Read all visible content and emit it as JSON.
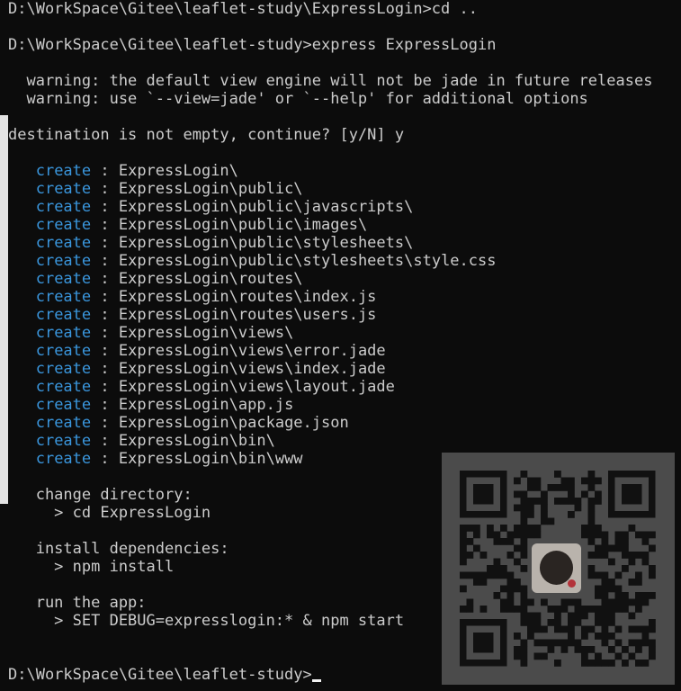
{
  "terminal": {
    "lines": [
      {
        "text": "D:\\WorkSpace\\Gitee\\leaflet-study\\ExpressLogin>cd .."
      },
      {
        "text": ""
      },
      {
        "text": "D:\\WorkSpace\\Gitee\\leaflet-study>express ExpressLogin"
      },
      {
        "text": ""
      },
      {
        "text": "  warning: the default view engine will not be jade in future releases"
      },
      {
        "text": "  warning: use `--view=jade' or `--help' for additional options"
      },
      {
        "text": ""
      },
      {
        "text": "destination is not empty, continue? [y/N] y"
      },
      {
        "text": ""
      },
      {
        "indent": "   ",
        "keyword": "create",
        "text": " : ExpressLogin\\"
      },
      {
        "indent": "   ",
        "keyword": "create",
        "text": " : ExpressLogin\\public\\"
      },
      {
        "indent": "   ",
        "keyword": "create",
        "text": " : ExpressLogin\\public\\javascripts\\"
      },
      {
        "indent": "   ",
        "keyword": "create",
        "text": " : ExpressLogin\\public\\images\\"
      },
      {
        "indent": "   ",
        "keyword": "create",
        "text": " : ExpressLogin\\public\\stylesheets\\"
      },
      {
        "indent": "   ",
        "keyword": "create",
        "text": " : ExpressLogin\\public\\stylesheets\\style.css"
      },
      {
        "indent": "   ",
        "keyword": "create",
        "text": " : ExpressLogin\\routes\\"
      },
      {
        "indent": "   ",
        "keyword": "create",
        "text": " : ExpressLogin\\routes\\index.js"
      },
      {
        "indent": "   ",
        "keyword": "create",
        "text": " : ExpressLogin\\routes\\users.js"
      },
      {
        "indent": "   ",
        "keyword": "create",
        "text": " : ExpressLogin\\views\\"
      },
      {
        "indent": "   ",
        "keyword": "create",
        "text": " : ExpressLogin\\views\\error.jade"
      },
      {
        "indent": "   ",
        "keyword": "create",
        "text": " : ExpressLogin\\views\\index.jade"
      },
      {
        "indent": "   ",
        "keyword": "create",
        "text": " : ExpressLogin\\views\\layout.jade"
      },
      {
        "indent": "   ",
        "keyword": "create",
        "text": " : ExpressLogin\\app.js"
      },
      {
        "indent": "   ",
        "keyword": "create",
        "text": " : ExpressLogin\\package.json"
      },
      {
        "indent": "   ",
        "keyword": "create",
        "text": " : ExpressLogin\\bin\\"
      },
      {
        "indent": "   ",
        "keyword": "create",
        "text": " : ExpressLogin\\bin\\www"
      },
      {
        "text": ""
      },
      {
        "text": "   change directory:"
      },
      {
        "text": "     > cd ExpressLogin"
      },
      {
        "text": ""
      },
      {
        "text": "   install dependencies:"
      },
      {
        "text": "     > npm install"
      },
      {
        "text": ""
      },
      {
        "text": "   run the app:"
      },
      {
        "text": "     > SET DEBUG=expresslogin:* & npm start"
      },
      {
        "text": ""
      },
      {
        "text": ""
      },
      {
        "text": "D:\\WorkSpace\\Gitee\\leaflet-study>",
        "cursor": true
      }
    ]
  },
  "colors": {
    "background": "#0c0c0c",
    "foreground": "#cccccc",
    "create_keyword": "#3a96dd",
    "qr_background": "#4b4b4b"
  },
  "overlay": {
    "icon": "qr-code-icon"
  }
}
